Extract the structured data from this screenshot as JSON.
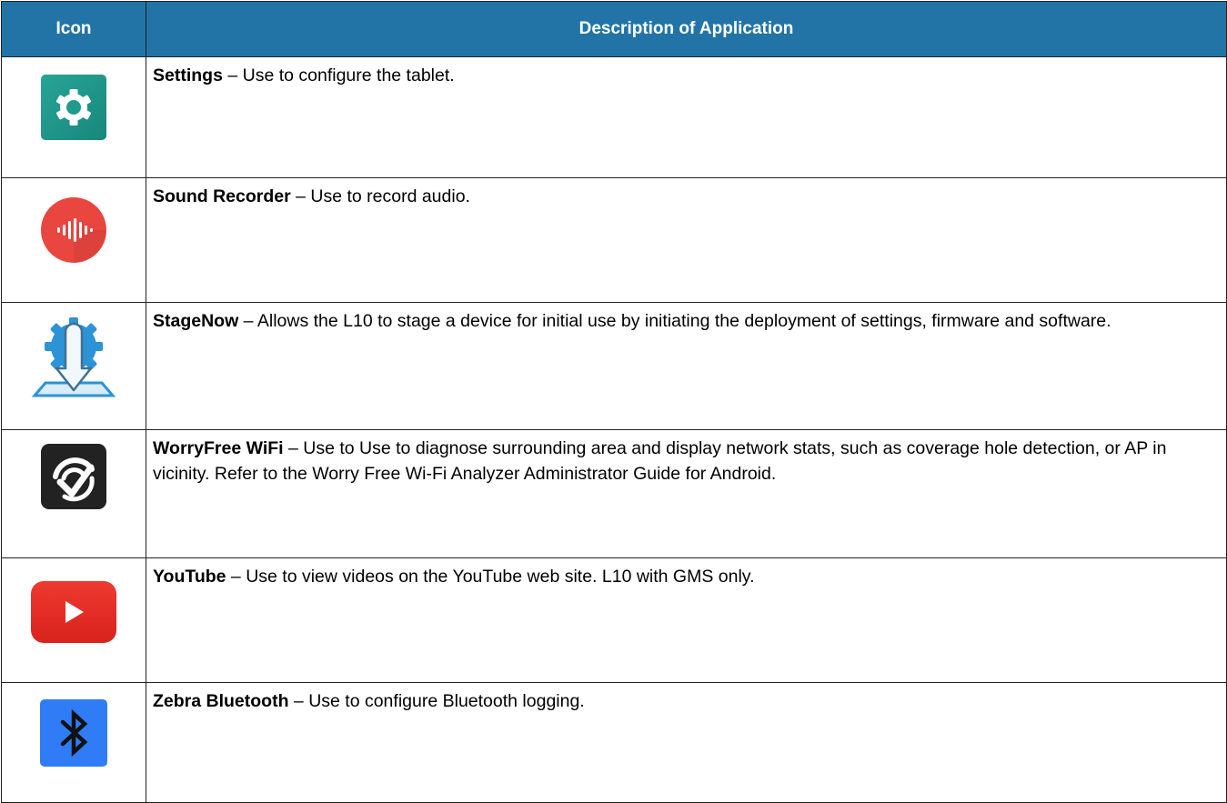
{
  "table": {
    "headers": {
      "icon": "Icon",
      "description": "Description of Application"
    },
    "rows": [
      {
        "icon": "settings-gear-icon",
        "icon_color": "#1f9a8d",
        "name": "Settings",
        "separator": " – ",
        "description": "Use to configure the tablet."
      },
      {
        "icon": "sound-recorder-waveform-icon",
        "icon_color": "#e8463f",
        "name": "Sound Recorder",
        "separator": " – ",
        "description": "Use to record audio."
      },
      {
        "icon": "stagenow-download-gear-icon",
        "icon_color": "#2c93d6",
        "name": "StageNow",
        "separator": " – ",
        "description": "Allows the L10 to stage a device for initial use by initiating the deployment of settings, firmware and software."
      },
      {
        "icon": "worryfree-wifi-check-icon",
        "icon_color": "#222222",
        "name": "WorryFree WiFi",
        "separator": " – ",
        "description": "Use to Use to diagnose surrounding area and display network stats, such as coverage hole detection, or AP in vicinity. Refer to the Worry Free Wi-Fi Analyzer Administrator Guide for Android."
      },
      {
        "icon": "youtube-play-icon",
        "icon_color": "#e52d27",
        "name": "YouTube",
        "separator": " – ",
        "description": "Use to view videos on the YouTube web site. L10 with GMS only."
      },
      {
        "icon": "bluetooth-icon",
        "icon_color": "#2f7cf6",
        "name": "Zebra Bluetooth",
        "separator": " – ",
        "description": "Use to configure Bluetooth logging."
      }
    ]
  }
}
